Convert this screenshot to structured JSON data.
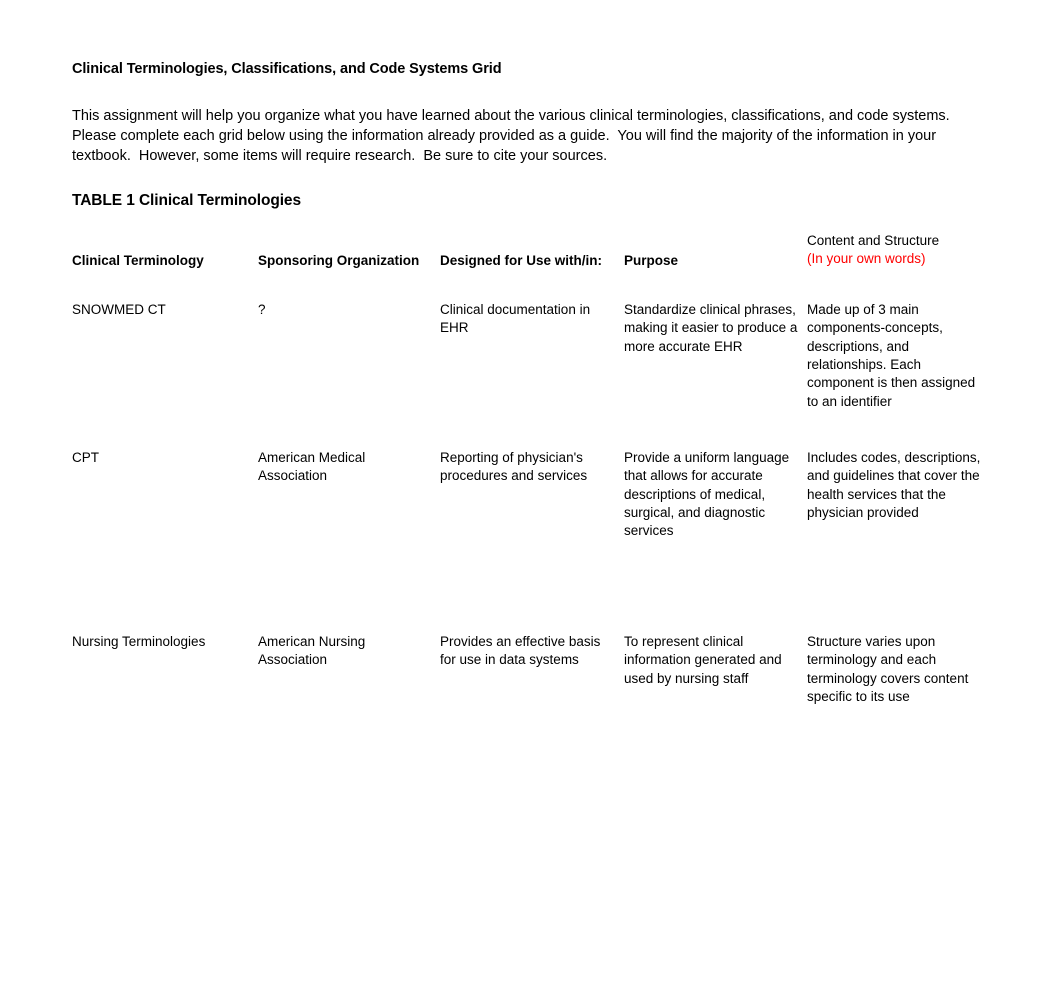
{
  "document": {
    "title": "Clinical Terminologies, Classifications, and Code Systems Grid",
    "intro": {
      "line1": "This assignment will help you organize what you have learned about the various clinical terminologies, classifications, and code systems.",
      "line2": "Please complete each grid below using the information already provided as a guide.  You will find the majority of the information in your",
      "line3": "textbook.  However, some items will require research.  Be sure to cite your sources."
    },
    "table_heading": "TABLE 1 Clinical Terminologies"
  },
  "colors": {
    "text": "#000000",
    "accent_red": "#FF0000",
    "background": "#FFFFFF"
  },
  "table1": {
    "headers": {
      "col1": "Clinical Terminology",
      "col2": "Sponsoring Organization",
      "col3": "Designed for Use with/in:",
      "col4": "Purpose",
      "col5_line1": "Content and Structure",
      "col5_line2": "(In your own words)"
    },
    "rows": [
      {
        "terminology": "SNOWMED CT",
        "organization": "?",
        "designed_for": "Clinical documentation in EHR",
        "purpose": "Standardize clinical phrases, making it easier to produce a more accurate EHR",
        "content_structure": "Made up of 3 main components-concepts, descriptions, and relationships. Each component is then assigned to an identifier"
      },
      {
        "terminology": "CPT",
        "organization": "American Medical Association",
        "designed_for": "Reporting of physician's procedures and services",
        "purpose": "Provide a uniform language that allows for accurate descriptions of medical, surgical, and diagnostic services",
        "content_structure": "Includes codes, descriptions, and guidelines that cover the health services that the physician provided"
      },
      {
        "terminology": "Nursing Terminologies",
        "organization": "American Nursing Association",
        "designed_for": "Provides an effective basis for use in data systems",
        "purpose": "To represent clinical information generated and used by nursing staff",
        "content_structure": "Structure varies upon terminology and each terminology covers content specific to its use"
      }
    ]
  }
}
